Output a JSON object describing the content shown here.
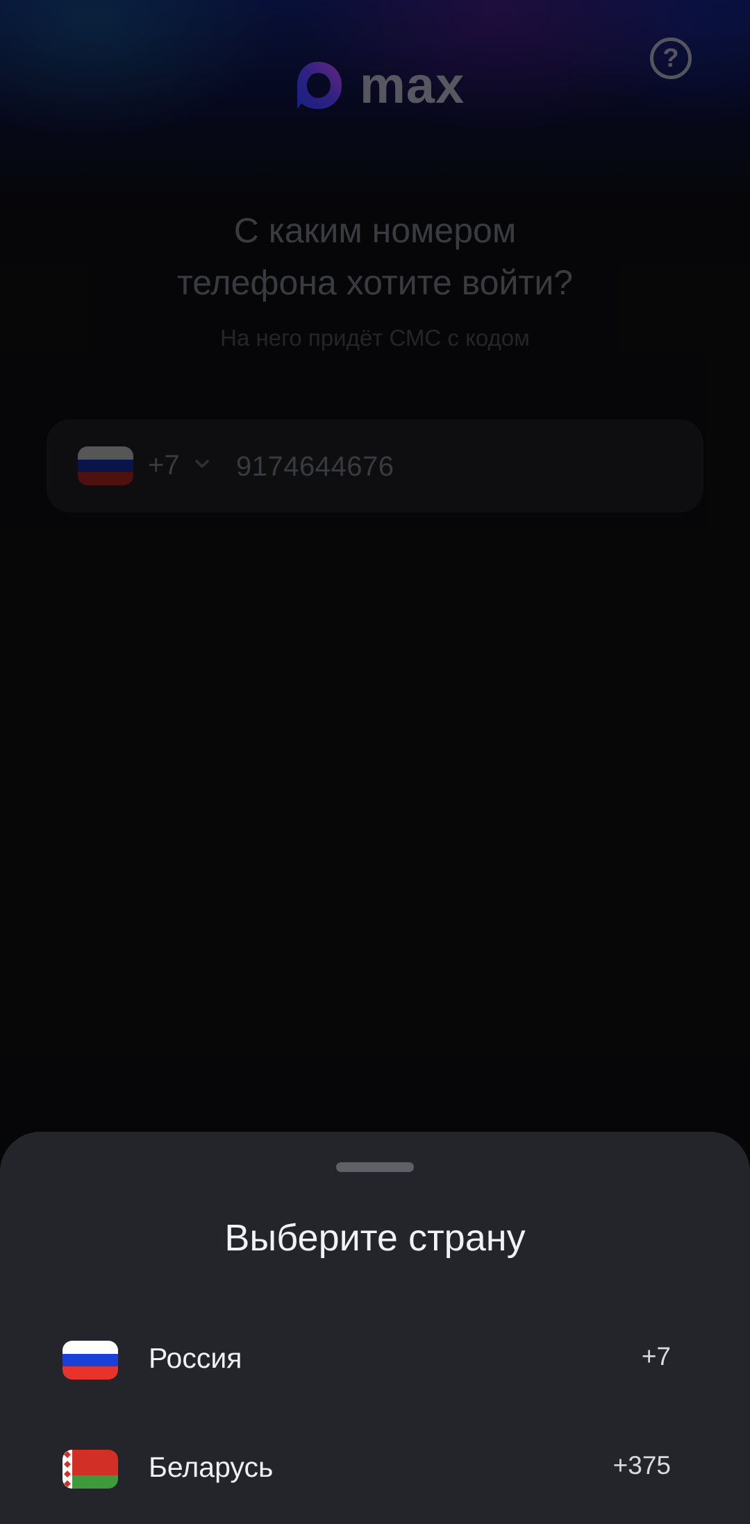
{
  "app": {
    "logo_text": "max"
  },
  "header": {
    "help_icon": "question-circle-icon",
    "help_glyph": "?"
  },
  "login": {
    "title_line1": "С каким номером",
    "title_line2": "телефона хотите войти?",
    "subtitle": "На него придёт СМС с кодом"
  },
  "phone": {
    "country_code": "+7",
    "number": "9174644676",
    "flag_icon": "russia-flag-icon",
    "dropdown_icon": "chevron-down-icon"
  },
  "country_sheet": {
    "title": "Выберите страну",
    "countries": [
      {
        "name": "Россия",
        "code": "+7",
        "flag_icon": "russia-flag-icon"
      },
      {
        "name": "Беларусь",
        "code": "+375",
        "flag_icon": "belarus-flag-icon"
      }
    ]
  },
  "colors": {
    "background": "#0b0b0d",
    "sheet": "#24252b",
    "ru_white": "#ffffff",
    "ru_blue": "#1c3fd6",
    "ru_red": "#e8322c",
    "by_red": "#d22f27",
    "by_green": "#3e9a3a"
  }
}
